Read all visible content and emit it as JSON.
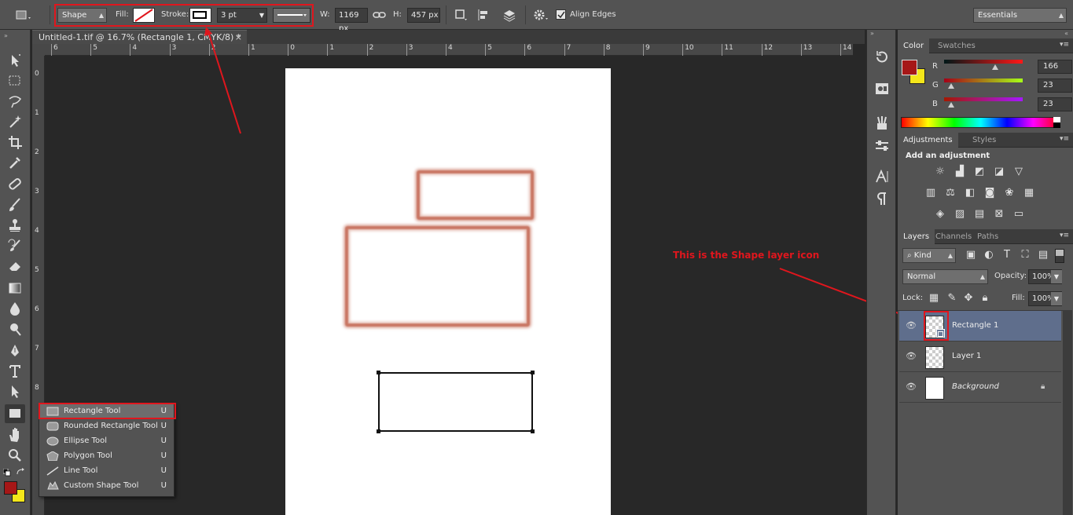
{
  "colors": {
    "accent": "#e0161d",
    "foreground": "#a61717",
    "background": "#f4e61a",
    "glow": "#c97764",
    "selected_layer": "#5f6e8c"
  },
  "options": {
    "tool_mode": "Shape",
    "fill_label": "Fill:",
    "stroke_label": "Stroke:",
    "stroke_width": "3 pt",
    "width_label": "W:",
    "width_value": "1169 px",
    "height_label": "H:",
    "height_value": "457 px",
    "align_edges_label": "Align Edges",
    "align_edges_checked": true,
    "workspace": "Essentials"
  },
  "document": {
    "tab_title": "Untitled-1.tif @ 16.7% (Rectangle 1, CMYK/8) *",
    "close": "×"
  },
  "ruler": {
    "h_labels": [
      "6",
      "5",
      "4",
      "3",
      "2",
      "1",
      "0",
      "1",
      "2",
      "3",
      "4",
      "5",
      "6",
      "7",
      "8",
      "9",
      "10",
      "11",
      "12",
      "13",
      "14"
    ],
    "v_labels": [
      "0",
      "1",
      "2",
      "3",
      "4",
      "5",
      "6",
      "7",
      "8"
    ]
  },
  "toolbar": {
    "tools": [
      "move-tool",
      "marquee-tool",
      "lasso-tool",
      "magic-wand-tool",
      "crop-tool",
      "eyedropper-tool",
      "healing-brush-tool",
      "brush-tool",
      "clone-stamp-tool",
      "history-brush-tool",
      "eraser-tool",
      "gradient-tool",
      "blur-tool",
      "dodge-tool",
      "pen-tool",
      "type-tool",
      "path-selection-tool",
      "rectangle-tool",
      "hand-tool",
      "zoom-tool"
    ]
  },
  "flyout": {
    "items": [
      {
        "name": "Rectangle Tool",
        "key": "U",
        "icon": "rectangle-icon",
        "active": true
      },
      {
        "name": "Rounded Rectangle Tool",
        "key": "U",
        "icon": "rounded-rectangle-icon"
      },
      {
        "name": "Ellipse Tool",
        "key": "U",
        "icon": "ellipse-icon"
      },
      {
        "name": "Polygon Tool",
        "key": "U",
        "icon": "polygon-icon"
      },
      {
        "name": "Line Tool",
        "key": "U",
        "icon": "line-icon"
      },
      {
        "name": "Custom Shape Tool",
        "key": "U",
        "icon": "custom-shape-icon"
      }
    ]
  },
  "color_panel": {
    "tabs": [
      "Color",
      "Swatches"
    ],
    "channels": [
      {
        "label": "R",
        "value": "166",
        "fraction": 0.651
      },
      {
        "label": "G",
        "value": "23",
        "fraction": 0.09
      },
      {
        "label": "B",
        "value": "23",
        "fraction": 0.09
      }
    ]
  },
  "adjustments_panel": {
    "tabs": [
      "Adjustments",
      "Styles"
    ],
    "heading": "Add an adjustment"
  },
  "layers_panel": {
    "tabs": [
      "Layers",
      "Channels",
      "Paths"
    ],
    "filter_kind": "Kind",
    "blend_mode": "Normal",
    "opacity_label": "Opacity:",
    "opacity_value": "100%",
    "lock_label": "Lock:",
    "fill_label": "Fill:",
    "fill_value": "100%",
    "layers": [
      {
        "name": "Rectangle 1",
        "selected": true
      },
      {
        "name": "Layer 1"
      },
      {
        "name": "Background",
        "italic": true,
        "locked": true
      }
    ]
  },
  "annotation": {
    "text": "This is the Shape layer icon"
  }
}
